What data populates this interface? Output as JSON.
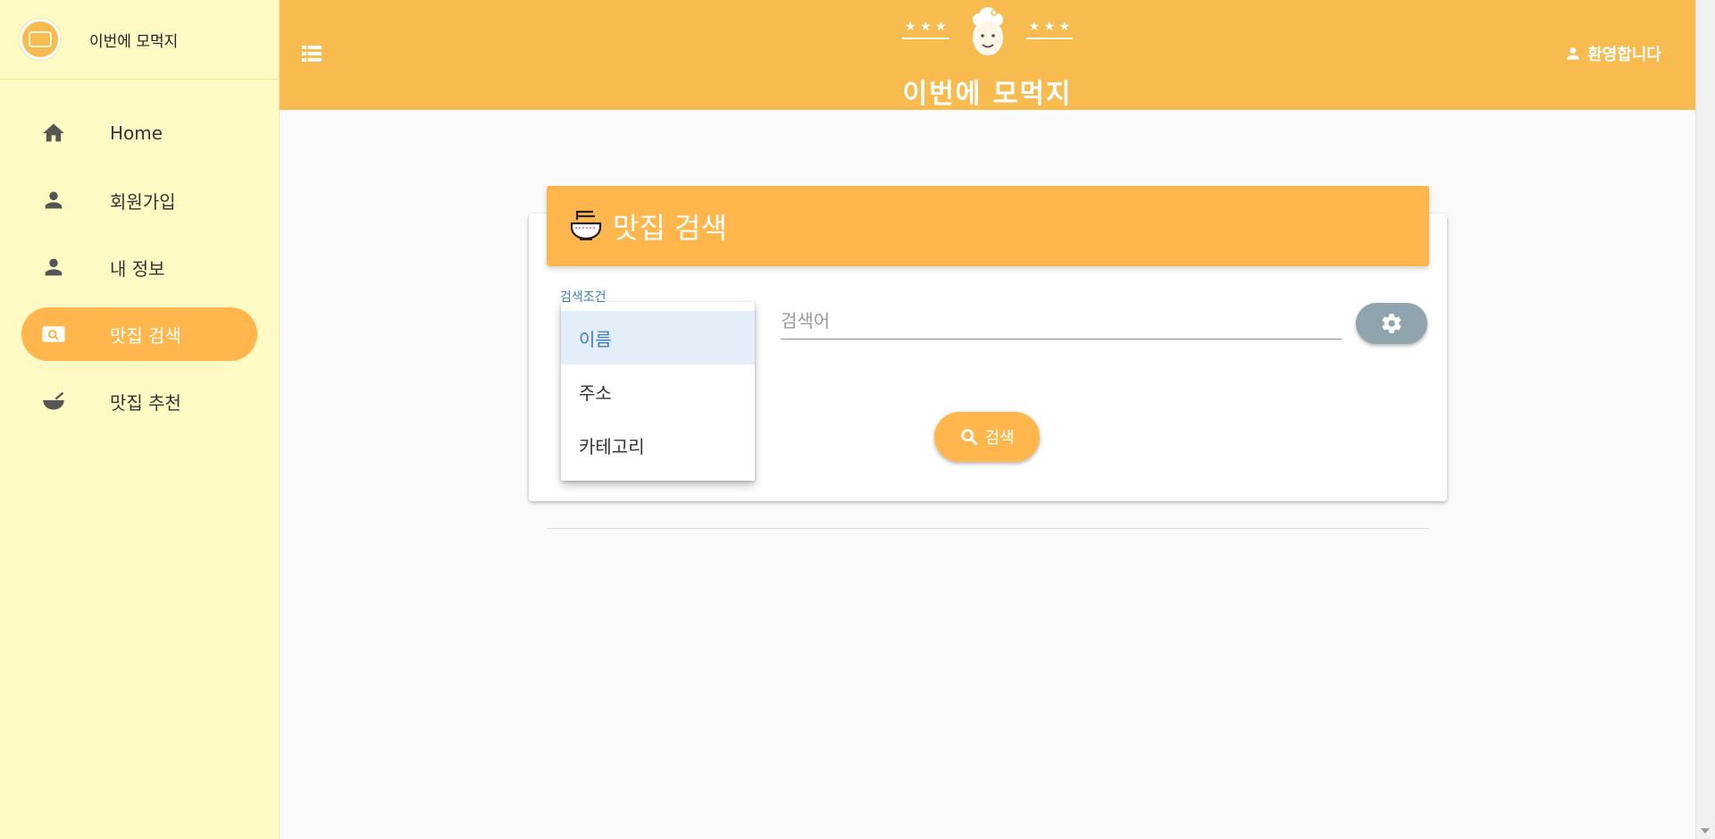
{
  "brand": {
    "title": "이번에 모먹지"
  },
  "sidebar": {
    "items": [
      {
        "label": "Home",
        "icon": "home-icon",
        "active": false
      },
      {
        "label": "회원가입",
        "icon": "person-icon",
        "active": false
      },
      {
        "label": "내 정보",
        "icon": "person-icon",
        "active": false
      },
      {
        "label": "맛집 검색",
        "icon": "image-search-icon",
        "active": true
      },
      {
        "label": "맛집 추천",
        "icon": "bowl-icon",
        "active": false
      }
    ]
  },
  "header": {
    "title": "이번에 모먹지",
    "stars_left": "★ ★ ★",
    "stars_right": "★ ★ ★",
    "welcome": "환영합니다"
  },
  "search": {
    "card_title": "맛집 검색",
    "condition_label": "검색조건",
    "query_placeholder": "검색어",
    "search_button": "검색",
    "dropdown_options": [
      "이름",
      "주소",
      "카테고리"
    ],
    "selected_option": "이름"
  },
  "colors": {
    "header_bg": "#f7bb4f",
    "sidebar_bg": "#fff9c4",
    "accent": "#ffb74d",
    "gear_button": "#90a4ae",
    "selected_text": "#3f7fc0"
  }
}
